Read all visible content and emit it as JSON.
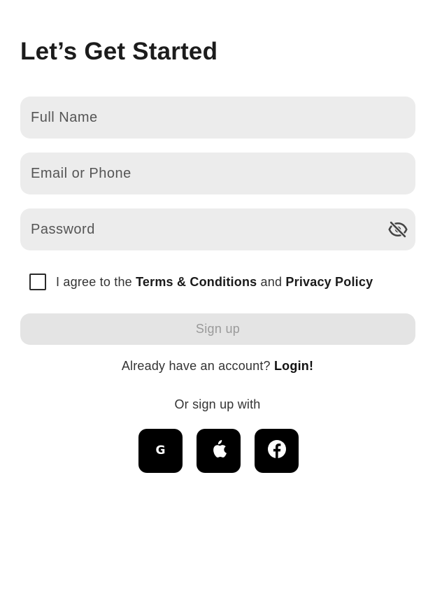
{
  "page": {
    "title": "Let’s Get Started"
  },
  "form": {
    "full_name": {
      "placeholder": "Full Name",
      "value": ""
    },
    "email": {
      "placeholder": "Email or Phone",
      "value": ""
    },
    "password": {
      "placeholder": "Password",
      "value": ""
    },
    "password_toggle_icon": "eye-off-icon"
  },
  "agreement": {
    "checked": false,
    "prefix": "I agree to the ",
    "terms_label": "Terms & Conditions",
    "middle": " and ",
    "privacy_label": "Privacy Policy"
  },
  "signup_button": {
    "label": "Sign up"
  },
  "login_prompt": {
    "text": "Already have an account? ",
    "link_label": "Login!"
  },
  "social": {
    "heading": "Or sign up with",
    "google_letter": "G",
    "buttons": [
      "google-icon",
      "apple-icon",
      "facebook-icon"
    ]
  },
  "colors": {
    "field_bg": "#ececec",
    "button_disabled_bg": "#e4e4e4",
    "button_disabled_text": "#9a9a9a",
    "social_bg": "#000000"
  }
}
